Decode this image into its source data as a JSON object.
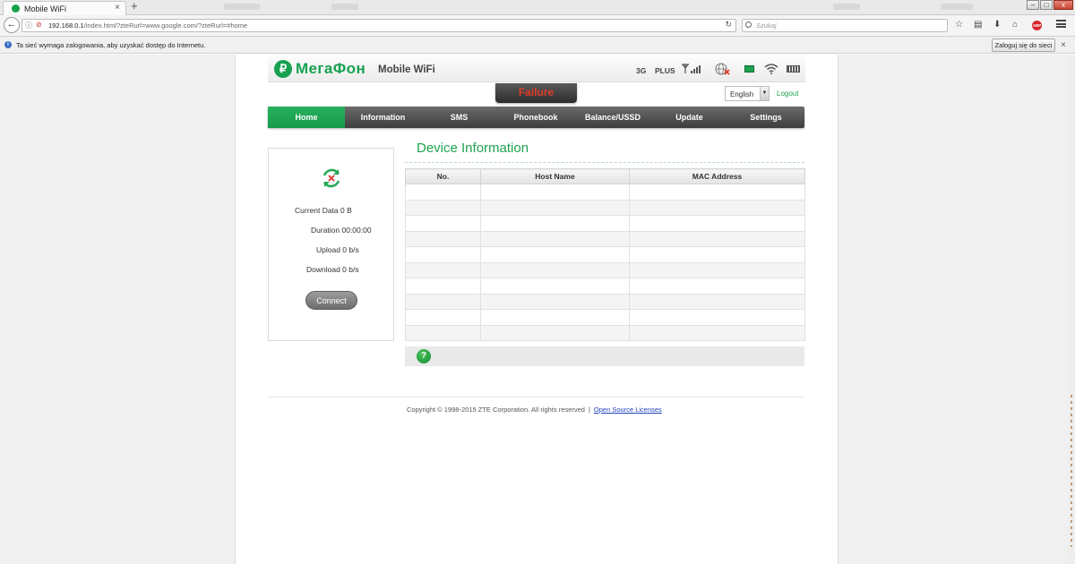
{
  "browser": {
    "tab_title": "Mobile WiFi",
    "tab_close": "×",
    "new_tab": "+",
    "url_host": "192.168.0.1",
    "url_path": "/index.html?zteRurl=www.google.com/?zteRurl=#home",
    "search_placeholder": "Szukaj",
    "window_buttons": {
      "minimize": "–",
      "maximize": "□",
      "close": "x"
    }
  },
  "notification": {
    "text": "Ta sieć wymaga zalogowania, aby uzyskać dostęp do Internetu.",
    "login_button": "Zaloguj się do sieci",
    "close": "×"
  },
  "header": {
    "brand": "МегаФон",
    "product": "Mobile WiFi",
    "network_type": "3G",
    "operator": "PLUS",
    "status_banner": "Failure",
    "language": "English",
    "logout": "Logout"
  },
  "nav": {
    "items": [
      "Home",
      "Information",
      "SMS",
      "Phonebook",
      "Balance/USSD",
      "Update",
      "Settings"
    ],
    "active": "Home"
  },
  "status_panel": {
    "current_data": "Current Data 0 B",
    "duration": "Duration 00:00:00",
    "upload": "Upload 0 b/s",
    "download": "Download 0 b/s",
    "connect_button": "Connect"
  },
  "device_info": {
    "title": "Device Information",
    "columns": [
      "No.",
      "Host Name",
      "MAC Address"
    ],
    "rows": 10
  },
  "footer": {
    "copyright": "Copyright © 1998-2015 ZTE Corporation. All rights reserved",
    "separator": "|",
    "license_link": "Open Source Licenses"
  },
  "colors": {
    "brand_green": "#16a150",
    "failure_red": "#e03c28",
    "nav_dark": "#4a4a4a"
  }
}
